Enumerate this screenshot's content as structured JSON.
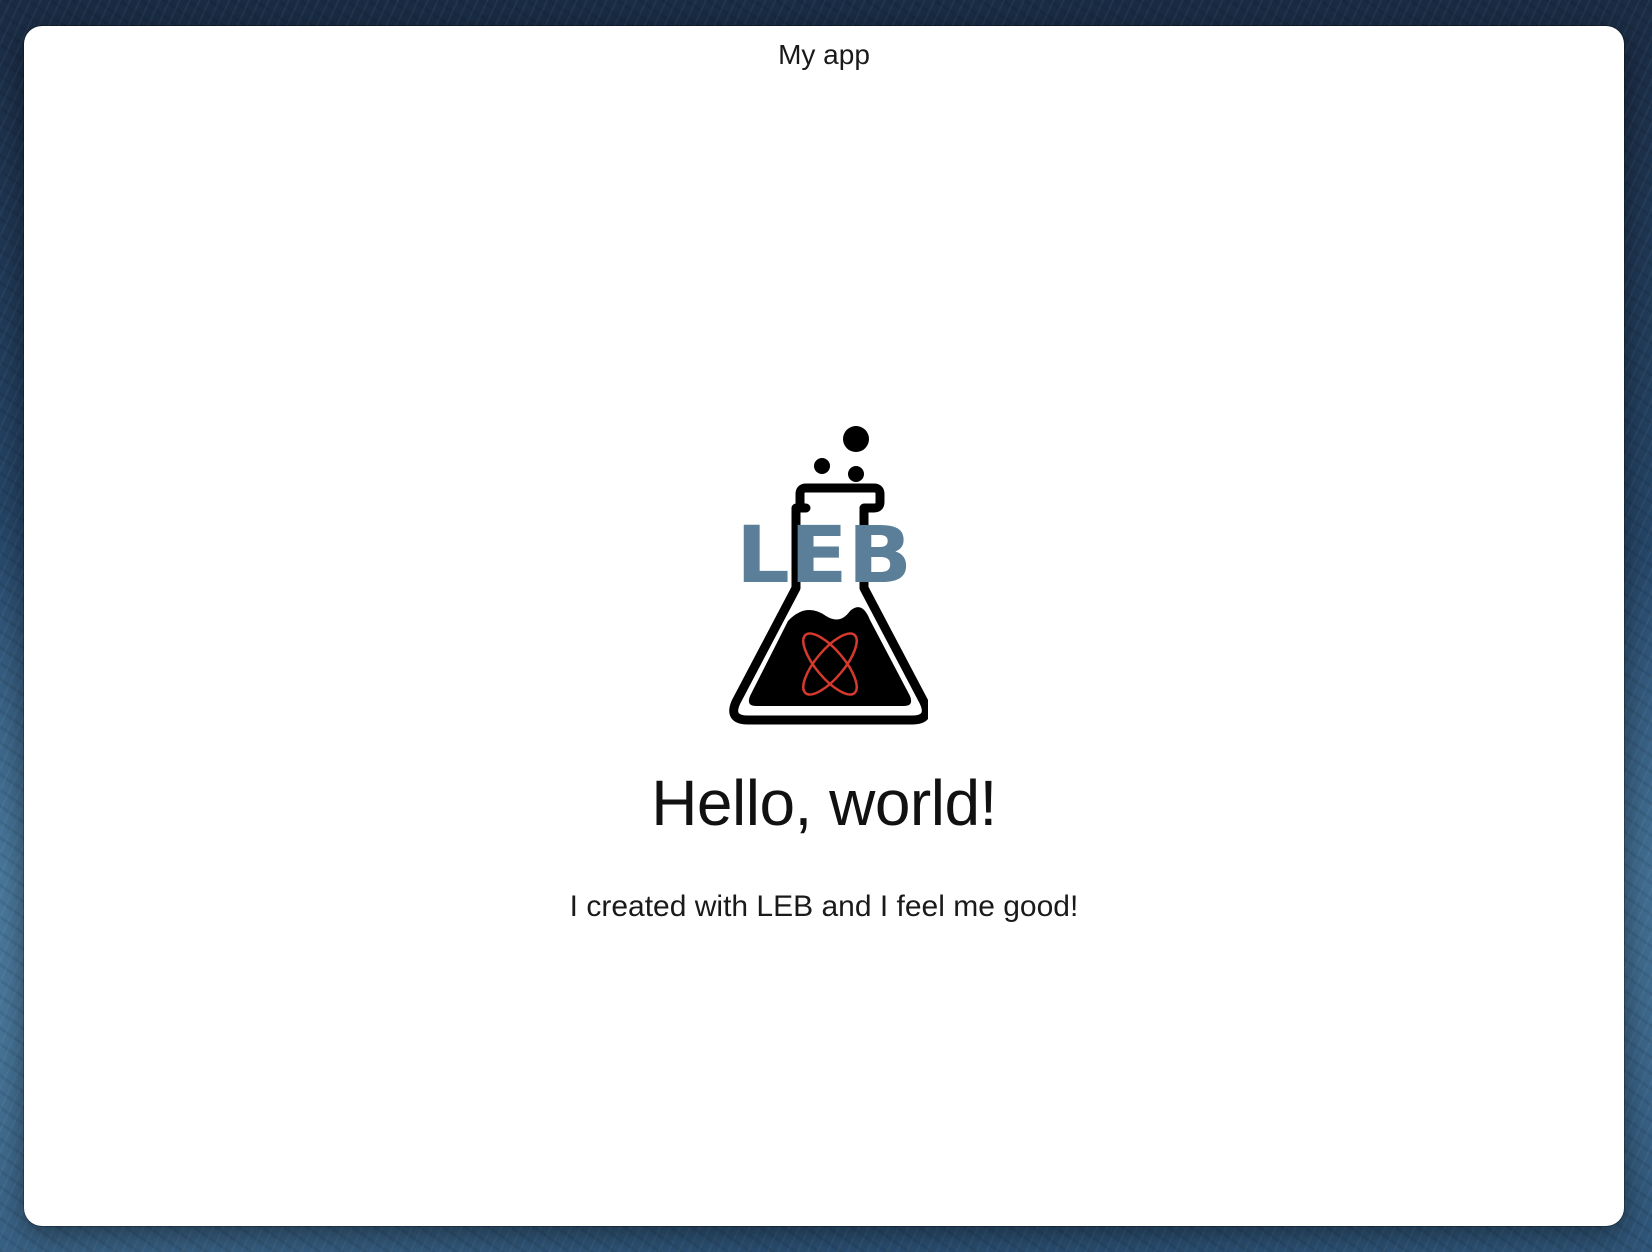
{
  "window": {
    "title": "My app"
  },
  "main": {
    "logo": {
      "icon": "erlenmeyer-flask-logo",
      "text": "LEB",
      "text_color": "#5b7f98",
      "accent_color": "#d63a2f"
    },
    "heading": "Hello, world!",
    "message": "I created with LEB and I feel me good!"
  }
}
